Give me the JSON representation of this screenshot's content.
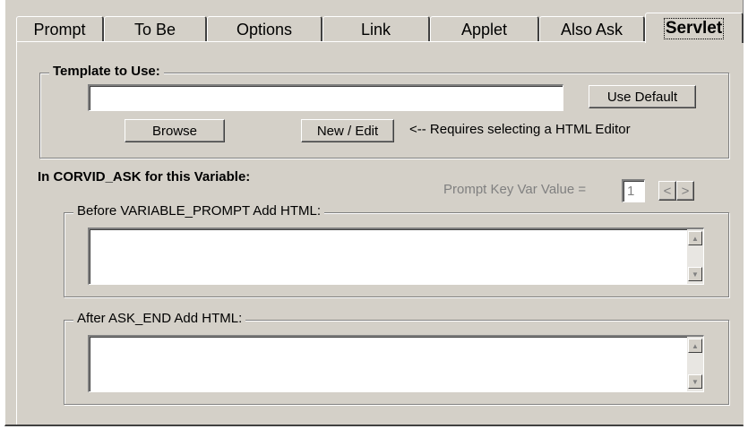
{
  "tabs": [
    {
      "label": "Prompt"
    },
    {
      "label": "To Be"
    },
    {
      "label": "Options"
    },
    {
      "label": "Link"
    },
    {
      "label": "Applet"
    },
    {
      "label": "Also Ask"
    },
    {
      "label": "Servlet"
    }
  ],
  "template_group": {
    "legend": "Template to Use:",
    "input_value": "",
    "use_default_label": "Use Default",
    "browse_label": "Browse",
    "new_edit_label": "New / Edit",
    "hint": "<-- Requires selecting a HTML Editor"
  },
  "corvid": {
    "heading": "In CORVID_ASK for this Variable:",
    "prompt_key_label": "Prompt Key Var Value =",
    "prompt_key_value": "1",
    "prev_label": "<",
    "next_label": ">"
  },
  "before_group": {
    "legend": "Before VARIABLE_PROMPT Add HTML:",
    "value": ""
  },
  "after_group": {
    "legend": "After ASK_END Add HTML:",
    "value": ""
  },
  "icons": {
    "scroll_up": "scroll-up-arrow-icon",
    "scroll_down": "scroll-down-arrow-icon"
  }
}
